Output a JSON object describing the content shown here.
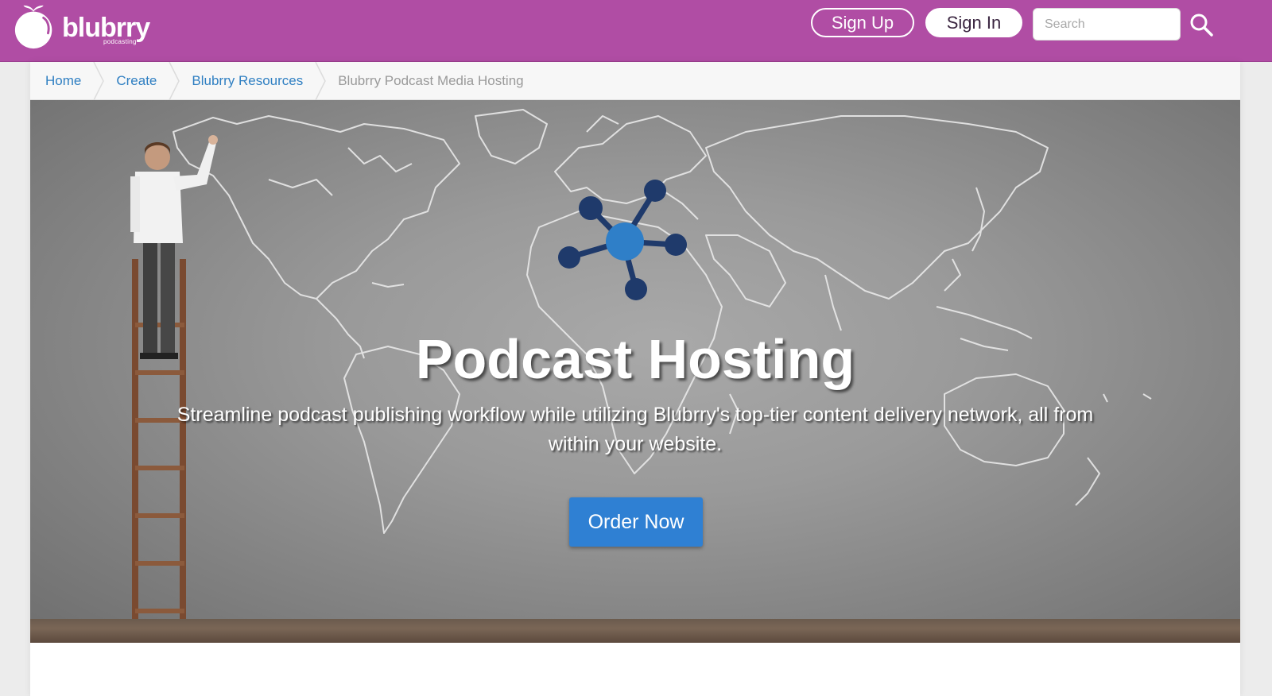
{
  "header": {
    "logo_text": "blubrry",
    "logo_subtext": "podcasting",
    "sign_up_label": "Sign Up",
    "sign_in_label": "Sign In",
    "search": {
      "placeholder": "Search",
      "value": ""
    },
    "search_icon": "search-icon",
    "brand_color": "#b04da4"
  },
  "breadcrumb": {
    "items": [
      {
        "label": "Home"
      },
      {
        "label": "Create"
      },
      {
        "label": "Blubrry Resources"
      },
      {
        "label": "Blubrry Podcast Media Hosting"
      }
    ]
  },
  "hero": {
    "title": "Podcast Hosting",
    "subtitle": "Streamline podcast publishing workflow while utilizing Blubrry's top-tier content delivery network, all from within your website.",
    "order_button_label": "Order Now",
    "accent_color": "#2f80d3",
    "network_icon": "network-hub-icon"
  }
}
